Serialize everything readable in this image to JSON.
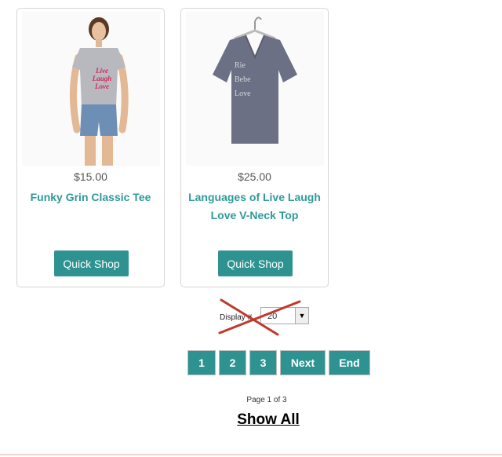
{
  "products": [
    {
      "price": "$15.00",
      "title": "Funky Grin Classic Tee",
      "button": "Quick Shop",
      "image_icon": "woman-tshirt-photo",
      "shirt_print": "Live Laugh Love"
    },
    {
      "price": "$25.00",
      "title": "Languages of Live Laugh Love V-Neck Top",
      "button": "Quick Shop",
      "image_icon": "vneck-top-photo",
      "shirt_print": "Rie Bebe Love"
    }
  ],
  "display": {
    "label": "Display #",
    "value": "20"
  },
  "pagination": {
    "pages": [
      "1",
      "2",
      "3"
    ],
    "next": "Next",
    "end": "End",
    "info": "Page 1 of 3"
  },
  "show_all": "Show All",
  "colors": {
    "accent": "#2e9390",
    "title_link": "#2e9a9a",
    "strike": "#c0392b"
  }
}
